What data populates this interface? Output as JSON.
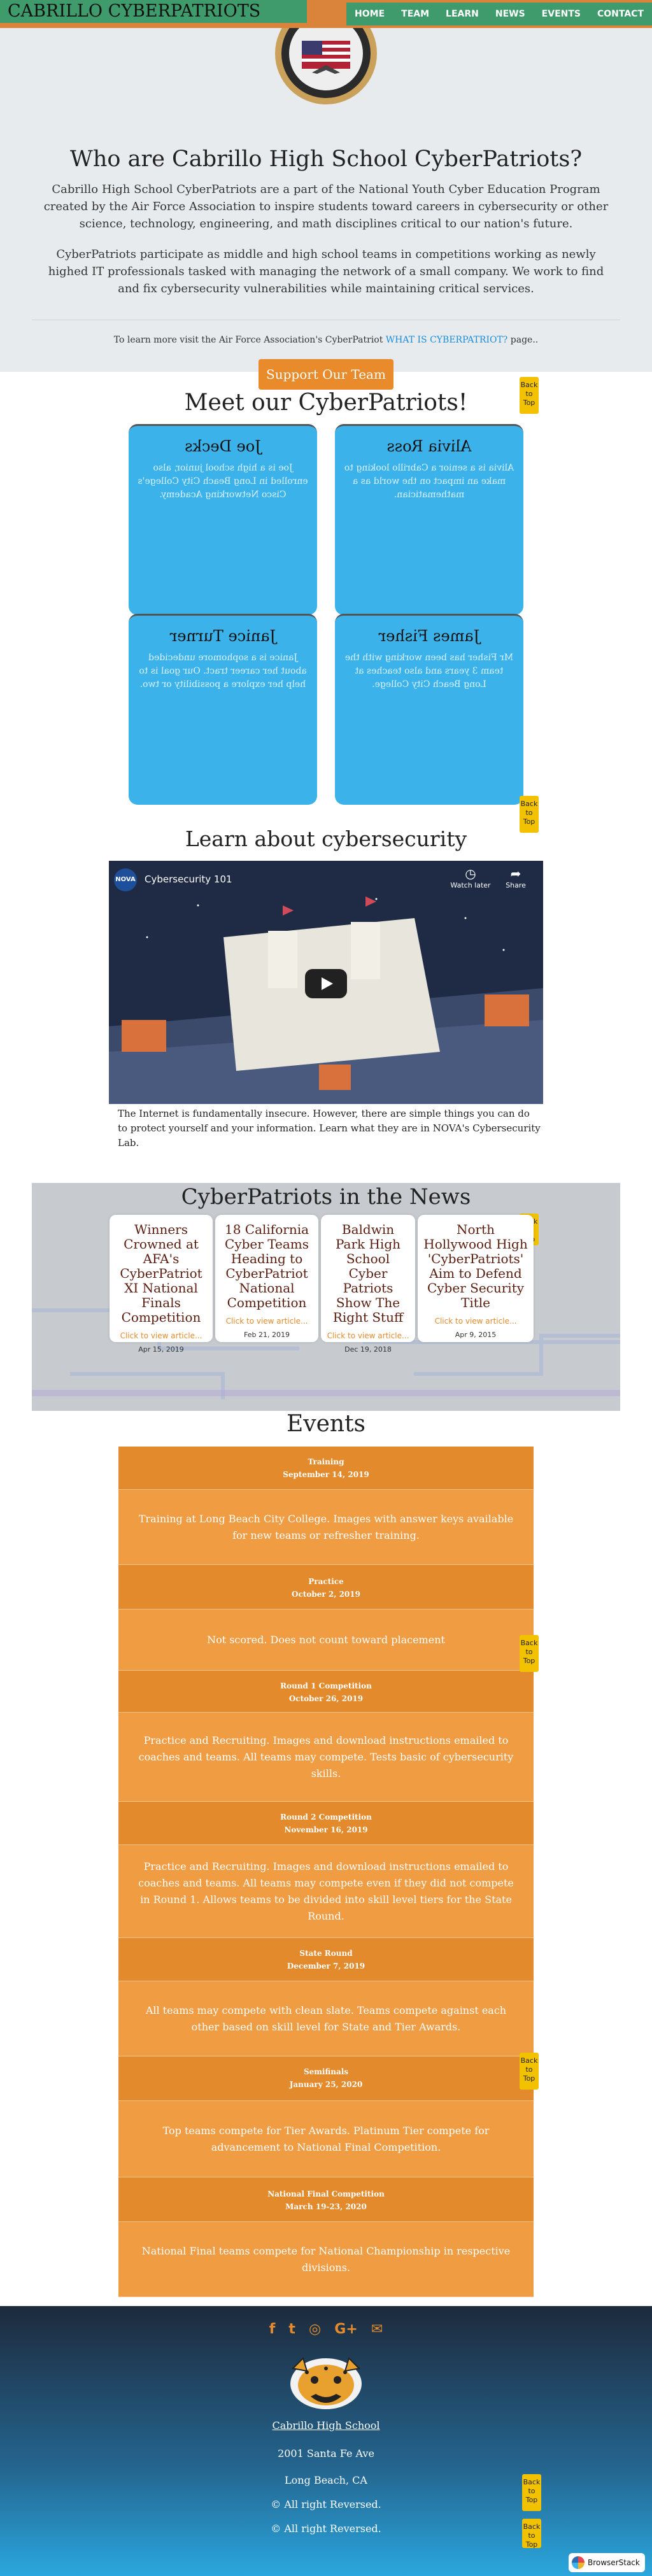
{
  "header": {
    "brand": "CABRILLO CYBERPATRIOTS",
    "nav": [
      "HOME",
      "TEAM",
      "LEARN",
      "NEWS",
      "EVENTS",
      "CONTACT"
    ]
  },
  "intro": {
    "title": "Who are Cabrillo High School CyberPatriots?",
    "p1": "Cabrillo High School CyberPatriots are a part of the National Youth Cyber Education Program created by the Air Force Association to inspire students toward careers in cybersecurity or other science, technology, engineering, and math disciplines critical to our nation's future.",
    "p2": "CyberPatriots participate as middle and high school teams in competitions working as newly highed IT professionals tasked with managing the network of a small company. We work to find and fix cybersecurity vulnerabilities while maintaining critical services.",
    "learn_prefix": "To learn more visit the Air Force Association's CyberPatriot ",
    "learn_link": "WHAT IS CYBERPATRIOT?",
    "learn_suffix": " page..",
    "support_button": "Support Our Team"
  },
  "back_to_top": "Back to Top",
  "team": {
    "title": "Meet our CyberPatriots!",
    "members": [
      {
        "name": "Joe Decks",
        "bio": "Joe is a high school junior, also enrolled in Long Beach City College's Cisco Networking Academy."
      },
      {
        "name": "Alivia Ross",
        "bio": "Alivia is a senior a Cabrillo looking to make an impact on the world as a mathematician."
      },
      {
        "name": "Janice Turner",
        "bio": "Janice is a sophomore undecided about her career tract. Our goal is to help her explore a possibility or two."
      },
      {
        "name": "James Fisher",
        "bio": "Mr Fisher has been working with the team 3 years and also teaches at Long Beach City College."
      }
    ]
  },
  "learn": {
    "title": "Learn about cybersecurity",
    "video": {
      "channel": "NOVA",
      "title": "Cybersecurity 101",
      "watch_later": "Watch later",
      "share": "Share"
    },
    "caption": "The Internet is fundamentally insecure. However, there are simple things you can do to protect yourself and your information. Learn what they are in NOVA's Cybersecurity Lab."
  },
  "news": {
    "title": "CyberPatriots in the News",
    "link_text": "Click to view article...",
    "articles": [
      {
        "headline": "Winners Crowned at AFA's CyberPatriot XI National Finals Competition",
        "date": "Apr 15, 2019"
      },
      {
        "headline": "18 California Cyber Teams Heading to CyberPatriot National Competition",
        "date": "Feb 21, 2019"
      },
      {
        "headline": "Baldwin Park High School Cyber Patriots Show The Right Stuff",
        "date": "Dec 19, 2018"
      },
      {
        "headline": "North Hollywood High 'CyberPatriots' Aim to Defend Cyber Security Title",
        "date": "Apr 9, 2015"
      }
    ]
  },
  "events": {
    "title": "Events",
    "items": [
      {
        "name": "Training",
        "date": "September 14, 2019",
        "desc": "Training at Long Beach City College. Images with answer keys available for new teams or refresher training."
      },
      {
        "name": "Practice",
        "date": "October 2, 2019",
        "desc": "Not scored. Does not count toward placement"
      },
      {
        "name": "Round 1 Competition",
        "date": "October 26, 2019",
        "desc": "Practice and Recruiting. Images and download instructions emailed to coaches and teams. All teams may compete. Tests basic of cybersecurity skills."
      },
      {
        "name": "Round 2 Competition",
        "date": "November 16, 2019",
        "desc": "Practice and Recruiting. Images and download instructions emailed to coaches and teams. All teams may compete even if they did not compete in Round 1. Allows teams to be divided into skill level tiers for the State Round."
      },
      {
        "name": "State Round",
        "date": "December 7, 2019",
        "desc": "All teams may compete with clean slate. Teams compete against each other based on skill level for State and Tier Awards."
      },
      {
        "name": "Semifinals",
        "date": "January 25, 2020",
        "desc": "Top teams compete for Tier Awards. Platinum Tier compete for advancement to National Final Competition."
      },
      {
        "name": "National Final Competition",
        "date": "March 19-23, 2020",
        "desc": "National Final teams compete for National Championship in respective divisions."
      }
    ]
  },
  "footer": {
    "social_icons": [
      "f",
      "t",
      "◎",
      "G+",
      "✉"
    ],
    "school_link": "Cabrillo High School",
    "address": "2001 Santa Fe Ave",
    "city": "Long Beach, CA",
    "rights1": "© All right Reversed.",
    "rights2": "© All right Reversed."
  },
  "browserstack": "BrowserStack",
  "colors": {
    "orange": "#e38b2c",
    "green": "#3f9b6b",
    "team_blue": "#3bb3ea",
    "link_blue": "#1b8dd8",
    "back_to_top": "#f2c200"
  }
}
